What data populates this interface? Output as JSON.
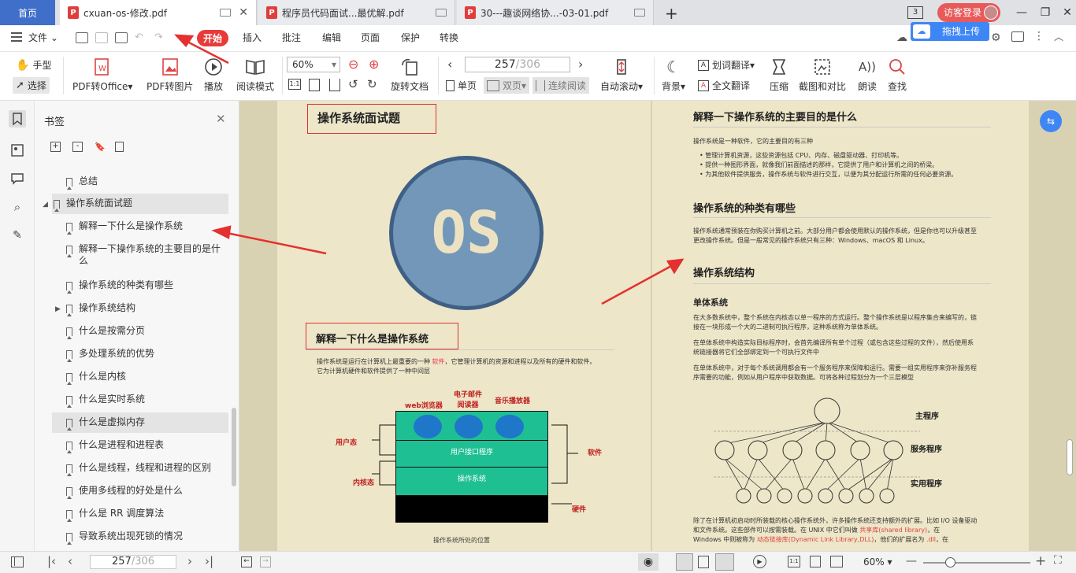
{
  "tabs": {
    "home": "首页",
    "doc1": "cxuan-os-修改.pdf",
    "doc2": "程序员代码面试...最优解.pdf",
    "doc3": "30---趣谈网络协...-03-01.pdf",
    "badge": "3",
    "login": "访客登录",
    "upload": "拖拽上传"
  },
  "menu": {
    "file": "文件",
    "start": "开始",
    "insert": "插入",
    "annotate": "批注",
    "edit": "编辑",
    "page": "页面",
    "protect": "保护",
    "convert": "转换"
  },
  "toolbar": {
    "hand": "手型",
    "select": "选择",
    "pdf_office": "PDF转Office",
    "pdf_image": "PDF转图片",
    "play": "播放",
    "read_mode": "阅读模式",
    "zoom": "60%",
    "rotate": "旋转文档",
    "page_current": "257",
    "page_total": "/306",
    "single": "单页",
    "double": "双页",
    "continuous": "连续阅读",
    "autoscroll": "自动滚动",
    "background": "背景",
    "word_translate": "划词翻译",
    "full_translate": "全文翻译",
    "compress": "压缩",
    "screenshot": "截图和对比",
    "read_aloud": "朗读",
    "find": "查找"
  },
  "panel": {
    "title": "书签",
    "items": [
      {
        "label": "总结"
      },
      {
        "label": "操作系统面试题"
      },
      {
        "label": "解释一下什么是操作系统"
      },
      {
        "label": "解释一下操作系统的主要目的是什"
      },
      {
        "label": "么"
      },
      {
        "label": "操作系统的种类有哪些"
      },
      {
        "label": "操作系统结构"
      },
      {
        "label": "什么是按需分页"
      },
      {
        "label": "多处理系统的优势"
      },
      {
        "label": "什么是内核"
      },
      {
        "label": "什么是实时系统"
      },
      {
        "label": "什么是虚拟内存"
      },
      {
        "label": "什么是进程和进程表"
      },
      {
        "label": "什么是线程，线程和进程的区别"
      },
      {
        "label": "使用多线程的好处是什么"
      },
      {
        "label": "什么是 RR 调度算法"
      },
      {
        "label": "导致系统出现死锁的情况"
      }
    ]
  },
  "left_page": {
    "title": "操作系统面试题",
    "logo_text": "OS",
    "h_what": "解释一下什么是操作系统",
    "p1a": "操作系统是运行在计算机上最重要的一种",
    "p1_hl": "软件",
    "p1b": "，它管理计算机的资源和进程以及所有的硬件和软件。",
    "p1c": "它为计算机硬件和软件提供了一种中间层",
    "lbl_web": "web浏览器",
    "lbl_email1": "电子邮件",
    "lbl_email2": "阅读器",
    "lbl_music": "音乐播放器",
    "lbl_user_mode": "用户态",
    "lbl_kernel_mode": "内核态",
    "lbl_software": "软件",
    "lbl_hardware": "硬件",
    "lbl_ui": "用户接口程序",
    "lbl_os": "操作系统",
    "caption": "操作系统所处的位置"
  },
  "right_page": {
    "h1": "解释一下操作系统的主要目的是什么",
    "p1": "操作系统是一种软件，它的主要目的有三种",
    "b1": "管理计算机资源，这些资源包括 CPU、内存、磁盘驱动器、打印机等。",
    "b2": "提供一种图形界面，就像我们前面描述的那样，它提供了用户和计算机之间的桥梁。",
    "b3": "为其他软件提供服务，操作系统与软件进行交互，以便为其分配运行所需的任何必要资源。",
    "h2": "操作系统的种类有哪些",
    "p2a": "操作系统通常预装在你购买计算机之前。大部分用户都会使用默认的操作系统，但是你也可以升级甚至",
    "p2b": "更改操作系统。但是一般常见的操作系统只有三种：Windows、macOS 和 Linux。",
    "h3": "操作系统结构",
    "h4": "单体系统",
    "p3a": "在大多数系统中，整个系统在内核态以单一程序的方式运行。整个操作系统是以程序集合来编写的，链",
    "p3b": "接在一块形成一个大的二进制可执行程序，这种系统称为单体系统。",
    "p4a": "在单体系统中构造实际目标程序时，会首先编译所有单个过程（或包含这些过程的文件），然后使用系",
    "p4b": "统链接器将它们全部绑定到一个可执行文件中",
    "p5a": "在单体系统中，对于每个系统调用都会有一个服务程序来保障和运行。需要一组实用程序来弥补服务程",
    "p5b": "序需要的功能，例如从用户程序中获取数据。可将各种过程划分为一个三层模型",
    "lbl_main": "主程序",
    "lbl_service": "服务程序",
    "lbl_util": "实用程序",
    "p6a": "除了在计算机初启动时所装载的核心操作系统外，许多操作系统还支持额外的扩展。比如 I/O 设备驱动",
    "p6b": "和文件系统。这些部件可以按需装载。在 UNIX 中它们叫做",
    "p6_hl1": "共享库(shared library)",
    "p6c": "，在",
    "p6d": "Windows 中则被称为",
    "p6_hl2": "动态链接库(Dynamic Link Library,DLL)",
    "p6e": "，他们的扩展名为",
    "p6_hl3": ".dll",
    "p6f": "，在"
  },
  "status": {
    "page_current": "257",
    "page_total": "/306",
    "zoom": "60%"
  },
  "colors": {
    "accent_red": "#e83a3a",
    "home_tab": "#3f6fc9",
    "os_circle": "#6d93b4",
    "layer_green": "#1fbf94",
    "page_bg": "#ede6c8"
  }
}
